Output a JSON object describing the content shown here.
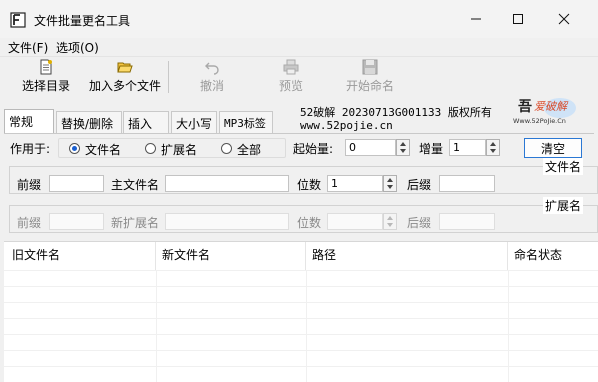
{
  "window": {
    "title": "文件批量更名工具",
    "minimize_icon": "minimize-icon",
    "maximize_icon": "maximize-icon",
    "close_icon": "close-icon"
  },
  "menu": [
    {
      "label": "文件(F)"
    },
    {
      "label": "选项(O)"
    }
  ],
  "toolbar": {
    "buttons": [
      {
        "label": "选择目录",
        "icon": "document-icon",
        "enabled": true
      },
      {
        "label": "加入多个文件",
        "icon": "folder-open-icon",
        "enabled": true
      },
      {
        "label": "撤消",
        "icon": "undo-icon",
        "enabled": false
      },
      {
        "label": "预览",
        "icon": "printer-icon",
        "enabled": false
      },
      {
        "label": "开始命名",
        "icon": "save-icon",
        "enabled": false
      }
    ]
  },
  "tabs": [
    {
      "label": "常规",
      "active": true
    },
    {
      "label": "替换/删除",
      "active": false
    },
    {
      "label": "插入",
      "active": false
    },
    {
      "label": "大小写",
      "active": false
    },
    {
      "label": "MP3标签",
      "active": false
    }
  ],
  "info": {
    "line1": "52破解 20230713G001133 版权所有",
    "line2": "www.52pojie.cn",
    "logo_text": "吾爱破解",
    "logo_url": "Www.52PoJie.Cn"
  },
  "general": {
    "apply_label": "作用于:",
    "radio_options": [
      {
        "label": "文件名",
        "selected": true
      },
      {
        "label": "扩展名",
        "selected": false
      },
      {
        "label": "全部",
        "selected": false
      }
    ],
    "start_label": "起始量:",
    "start_value": "0",
    "step_label": "增量",
    "step_value": "1",
    "clear_button": "清空"
  },
  "filename_group": {
    "caption": "文件名",
    "prefix_label": "前缀",
    "prefix_value": "",
    "main_label": "主文件名",
    "main_value": "",
    "digits_label": "位数",
    "digits_value": "1",
    "suffix_label": "后缀",
    "suffix_value": ""
  },
  "extension_group": {
    "caption": "扩展名",
    "prefix_label": "前缀",
    "prefix_value": "",
    "newext_label": "新扩展名",
    "newext_value": "",
    "digits_label": "位数",
    "digits_value": "",
    "suffix_label": "后缀",
    "suffix_value": ""
  },
  "list": {
    "columns": [
      "旧文件名",
      "新文件名",
      "路径",
      "命名状态"
    ]
  },
  "colors": {
    "accent": "#2b78d4",
    "radio_selected": "#1a5fd0",
    "disabled_text": "#9a9a9a"
  }
}
